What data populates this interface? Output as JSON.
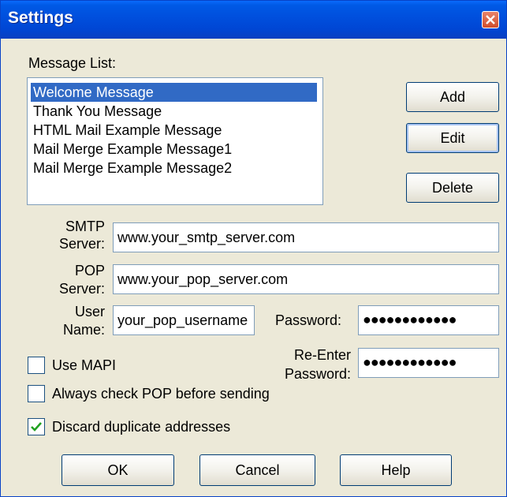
{
  "window": {
    "title": "Settings"
  },
  "message_list": {
    "label": "Message List:",
    "items": [
      {
        "label": "Welcome Message",
        "selected": true
      },
      {
        "label": "Thank You Message",
        "selected": false
      },
      {
        "label": "HTML Mail Example Message",
        "selected": false
      },
      {
        "label": "Mail Merge Example Message1",
        "selected": false
      },
      {
        "label": "Mail Merge Example Message2",
        "selected": false
      }
    ]
  },
  "buttons": {
    "add": "Add",
    "edit": "Edit",
    "delete": "Delete",
    "ok": "OK",
    "cancel": "Cancel",
    "help": "Help"
  },
  "smtp": {
    "label_line1": "SMTP",
    "label_line2": "Server:",
    "value": "www.your_smtp_server.com"
  },
  "pop": {
    "label_line1": "POP",
    "label_line2": "Server:",
    "value": "www.your_pop_server.com"
  },
  "user": {
    "label_line1": "User",
    "label_line2": "Name:",
    "value": "your_pop_username"
  },
  "password": {
    "label": "Password:",
    "value": "●●●●●●●●●●●●"
  },
  "reenter": {
    "label_line1": "Re-Enter",
    "label_line2": "Password:",
    "value": "●●●●●●●●●●●●"
  },
  "checkboxes": {
    "use_mapi": {
      "label": "Use MAPI",
      "checked": false
    },
    "check_pop": {
      "label": "Always check POP before sending",
      "checked": false
    },
    "discard_dup": {
      "label": "Discard duplicate addresses",
      "checked": true
    }
  },
  "colors": {
    "titlebar": "#0054e3",
    "selection": "#316ac5",
    "face": "#ece9d8"
  }
}
